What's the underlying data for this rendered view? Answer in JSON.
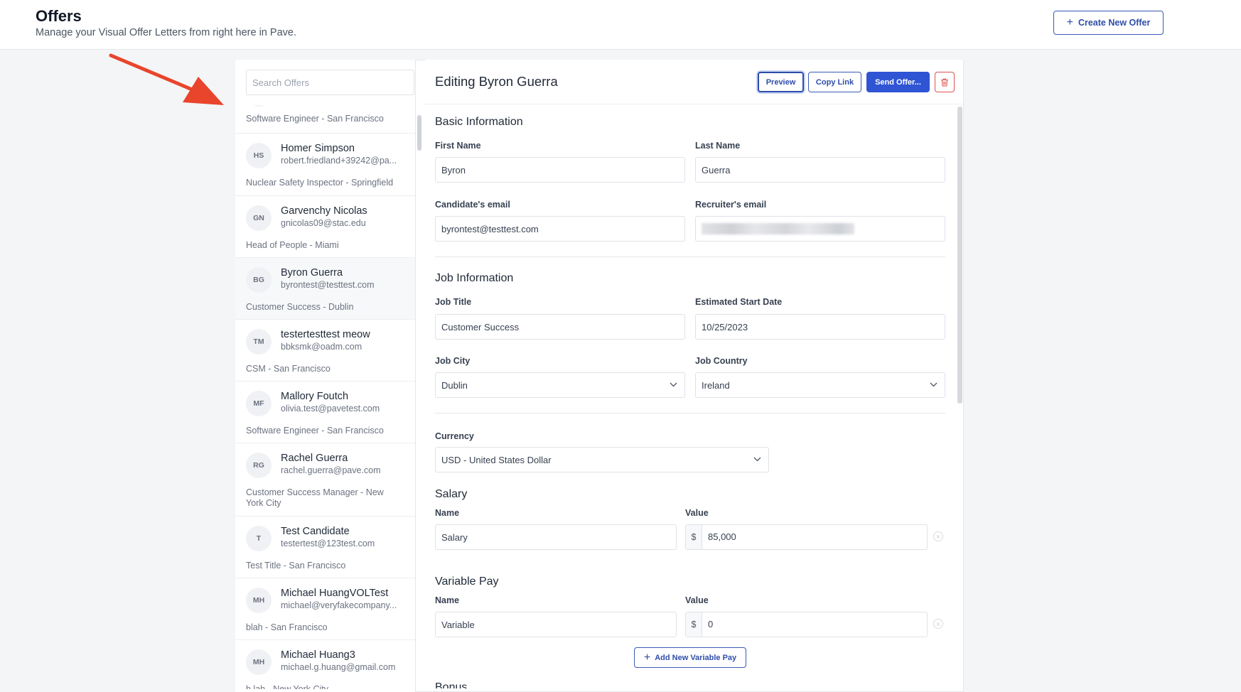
{
  "header": {
    "title": "Offers",
    "subtitle": "Manage your Visual Offer Letters from right here in Pave.",
    "create_button": "Create New Offer"
  },
  "search": {
    "placeholder": "Search Offers"
  },
  "offers_list": {
    "partial_first_role": "Software Engineer - San Francisco",
    "items": [
      {
        "initials": "HS",
        "name": "Homer Simpson",
        "email": "robert.friedland+39242@pa...",
        "role": "Nuclear Safety Inspector - Springfield"
      },
      {
        "initials": "GN",
        "name": "Garvenchy Nicolas",
        "email": "gnicolas09@stac.edu",
        "role": "Head of People - Miami"
      },
      {
        "initials": "BG",
        "name": "Byron Guerra",
        "email": "byrontest@testtest.com",
        "role": "Customer Success - Dublin",
        "selected": true
      },
      {
        "initials": "TM",
        "name": "testertesttest meow",
        "email": "bbksmk@oadm.com",
        "role": "CSM - San Francisco"
      },
      {
        "initials": "MF",
        "name": "Mallory Foutch",
        "email": "olivia.test@pavetest.com",
        "role": "Software Engineer - San Francisco"
      },
      {
        "initials": "RG",
        "name": "Rachel Guerra",
        "email": "rachel.guerra@pave.com",
        "role": "Customer Success Manager - New York City"
      },
      {
        "initials": "T",
        "name": "Test Candidate",
        "email": "testertest@123test.com",
        "role": "Test Title - San Francisco"
      },
      {
        "initials": "MH",
        "name": "Michael HuangVOLTest",
        "email": "michael@veryfakecompany...",
        "role": "blah - San Francisco"
      },
      {
        "initials": "MH",
        "name": "Michael Huang3",
        "email": "michael.g.huang@gmail.com",
        "role": "b.lah - New York City"
      }
    ]
  },
  "editor": {
    "title": "Editing Byron Guerra",
    "buttons": {
      "preview": "Preview",
      "copy_link": "Copy Link",
      "send": "Send Offer..."
    },
    "basic": {
      "section": "Basic Information",
      "first_name_label": "First Name",
      "first_name": "Byron",
      "last_name_label": "Last Name",
      "last_name": "Guerra",
      "candidate_email_label": "Candidate's email",
      "candidate_email": "byrontest@testtest.com",
      "recruiter_email_label": "Recruiter's email"
    },
    "job": {
      "section": "Job Information",
      "title_label": "Job Title",
      "title": "Customer Success",
      "start_label": "Estimated Start Date",
      "start": "10/25/2023",
      "city_label": "Job City",
      "city": "Dublin",
      "country_label": "Job Country",
      "country": "Ireland"
    },
    "currency": {
      "label": "Currency",
      "value": "USD - United States Dollar"
    },
    "salary": {
      "section": "Salary",
      "name_label": "Name",
      "name": "Salary",
      "value_label": "Value",
      "symbol": "$",
      "value": "85,000"
    },
    "variable": {
      "section": "Variable Pay",
      "name_label": "Name",
      "name": "Variable",
      "value_label": "Value",
      "symbol": "$",
      "value": "0",
      "add_button": "Add New Variable Pay"
    },
    "next_section": "Bonus"
  },
  "colors": {
    "primary": "#2f55d4",
    "outline": "#3b5bb5",
    "danger": "#d9534f",
    "arrow": "#e8452c"
  }
}
